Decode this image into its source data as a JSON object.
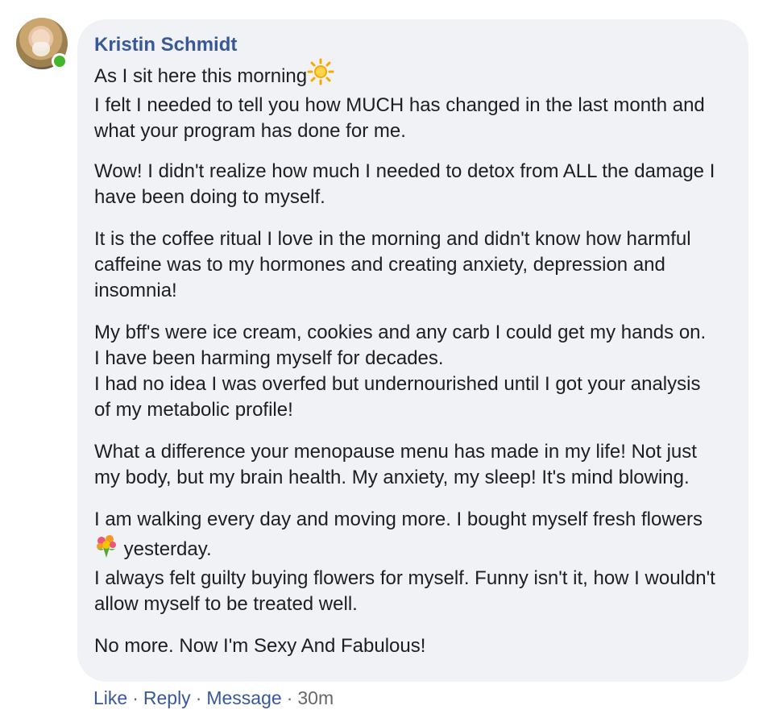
{
  "comment": {
    "author": "Kristin Schmidt",
    "author_online": true,
    "paragraphs": [
      {
        "lines": [
          "As I sit here this morning",
          "I felt I needed to tell you how MUCH has changed in the last month and what your program has done for me."
        ],
        "emoji_after_first": "sun-icon"
      },
      {
        "lines": [
          "Wow! I didn't realize how much I needed to detox from ALL the damage I have been doing to myself."
        ]
      },
      {
        "lines": [
          "It is the coffee ritual I love in the morning and didn't know how harmful caffeine was to my hormones and creating anxiety, depression and insomnia!"
        ]
      },
      {
        "lines": [
          "My bff's were ice cream, cookies and any carb I could get my hands on. I have been harming myself for decades.",
          "I had no idea I was overfed but undernourished until I got your analysis of my metabolic profile!"
        ]
      },
      {
        "lines": [
          "What a difference your menopause menu has made in my life! Not just my body, but my brain health. My anxiety, my sleep! It's mind blowing."
        ]
      },
      {
        "flowers_before": "I am walking every day and moving more. I bought myself fresh flowers",
        "flowers_after": "yesterday.",
        "second_line": "I always felt guilty buying flowers for myself. Funny isn't it, how I wouldn't allow myself to be treated well."
      },
      {
        "lines": [
          "No more. Now I'm Sexy And Fabulous!"
        ]
      }
    ]
  },
  "actions": {
    "like": "Like",
    "reply": "Reply",
    "message": "Message",
    "separator": "·",
    "time": "30m"
  },
  "colors": {
    "bubble": "#f0f2f5",
    "link": "#385898",
    "meta": "#65676b",
    "online": "#42b72a"
  }
}
